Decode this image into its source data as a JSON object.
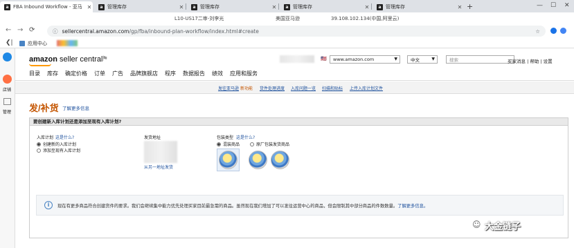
{
  "browser": {
    "tabs": [
      {
        "label": "FBA Inbound Workflow - 亚马",
        "active": true
      },
      {
        "label": "管理库存",
        "active": false
      },
      {
        "label": "管理库存",
        "active": false
      },
      {
        "label": "管理库存",
        "active": false
      },
      {
        "label": "管理库存",
        "active": false
      }
    ],
    "new_tab": "+",
    "info": {
      "shop": "L10-US17二审-刘李光",
      "region": "美国亚马逊",
      "ip": "39.108.102.134(中国,阿里云)"
    },
    "url_host": "sellercentral.amazon.com",
    "url_path": "/gp/fba/inbound-plan-workflow/index.html#create",
    "bookmark_label": "应用中心"
  },
  "rail": {
    "store_label": "店铺",
    "manage_label": "管理"
  },
  "header": {
    "logo_brand": "amazon",
    "logo_suffix": " seller central",
    "marketplace": "www.amazon.com",
    "language": "中文",
    "search_placeholder": "搜索",
    "links": "买家消息 | 帮助 | 设置",
    "nav": [
      "目录",
      "库存",
      "确定价格",
      "订单",
      "广告",
      "品牌旗舰店",
      "程序",
      "数据报告",
      "绩效",
      "应用和服务"
    ]
  },
  "subnav": [
    "发往亚马逊",
    "新功能",
    "货件处理进度",
    "入库问题一览",
    "扫描和贴标",
    "上传入库计划文件"
  ],
  "page": {
    "title": "发/补货",
    "learn_more": "了解更多信息",
    "question": "要创建新入库计划还是添加至现有入库计划?",
    "plan_label": "入库计划",
    "plan_help": "这是什么?",
    "opt_new": "创建新的入库计划",
    "opt_add": "添加至现有入库计划",
    "ship_from_label": "发货地址",
    "ship_from_link": "从另一地址发货",
    "pack_label": "包装类型",
    "pack_help": "这是什么?",
    "pack_individual": "混装商品",
    "pack_case": "原厂包装发货商品",
    "info_text": "现在有更多商品符合创建货件的要求。我们会继续集中能力优先处理买家目前最急需的商品。虽然现在我们增加了可以发往运营中心的商品，但会限制其中部分商品的件数数量。",
    "info_link": "了解更多信息。"
  },
  "watermark": "大金链子"
}
